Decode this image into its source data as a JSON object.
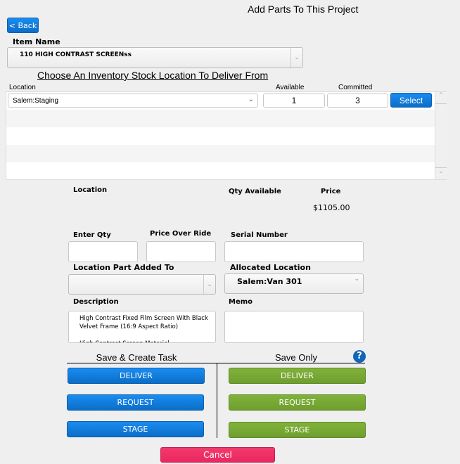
{
  "header": {
    "title": "Add Parts To This Project",
    "back_label": "< Back"
  },
  "item": {
    "label": "Item Name",
    "value": "110 HIGH CONTRAST SCREENss"
  },
  "stock": {
    "heading": "Choose An Inventory Stock Location To Deliver From",
    "col_location": "Location",
    "col_available": "Available",
    "col_committed": "Committed",
    "rows": [
      {
        "location": "Salem:Staging",
        "available": "1",
        "committed": "3",
        "select_label": "Select"
      }
    ]
  },
  "summary": {
    "location_label": "Location",
    "qty_label": "Qty Available",
    "price_label": "Price",
    "price_value": "$1105.00"
  },
  "form": {
    "qty_label": "Enter Qty",
    "qty_value": "",
    "override_label": "Price Over Ride",
    "override_value": "",
    "serial_label": "Serial Number",
    "serial_value": "",
    "loc_added_label": "Location Part Added To",
    "loc_added_value": "",
    "allocated_label": "Allocated Location",
    "allocated_value": "Salem:Van 301",
    "description_label": "Description",
    "description_value": "High Contrast Fixed Film Screen With Black Velvet Frame (16:9 Aspect Ratio)\n\nHigh Contrast Screen Material",
    "memo_label": "Memo",
    "memo_value": ""
  },
  "actions": {
    "task_heading": "Save & Create Task",
    "save_heading": "Save Only",
    "deliver": "DELIVER",
    "request": "REQUEST",
    "stage": "STAGE",
    "cancel": "Cancel"
  },
  "colors": {
    "blue": "#0b6ec8",
    "green": "#76a633",
    "cancel": "#ee2c65"
  }
}
